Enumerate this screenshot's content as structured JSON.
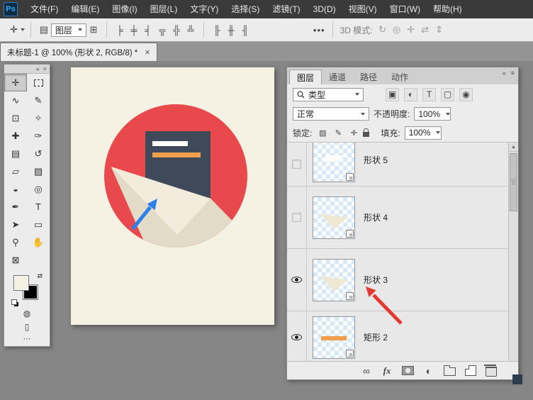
{
  "menu_bar": {
    "logo": "Ps",
    "items": [
      {
        "name": "menu-file",
        "label": "文件(F)"
      },
      {
        "name": "menu-edit",
        "label": "编辑(E)"
      },
      {
        "name": "menu-image",
        "label": "图像(I)"
      },
      {
        "name": "menu-layer",
        "label": "图层(L)"
      },
      {
        "name": "menu-type",
        "label": "文字(Y)"
      },
      {
        "name": "menu-select",
        "label": "选择(S)"
      },
      {
        "name": "menu-filter",
        "label": "滤镜(T)"
      },
      {
        "name": "menu-3d",
        "label": "3D(D)"
      },
      {
        "name": "menu-view",
        "label": "视图(V)"
      },
      {
        "name": "menu-window",
        "label": "窗口(W)"
      },
      {
        "name": "menu-help",
        "label": "帮助(H)"
      }
    ]
  },
  "options_bar": {
    "tool_glyph": "✛",
    "auto_select_glyph": "▤",
    "auto_select_value": "图层",
    "transform_glyph": "⊞",
    "align_icons": [
      {
        "name": "align-left-icon",
        "glyph": "╞"
      },
      {
        "name": "align-center-horizontal-icon",
        "glyph": "╪"
      },
      {
        "name": "align-right-icon",
        "glyph": "╡"
      },
      {
        "name": "align-top-icon",
        "glyph": "╦"
      },
      {
        "name": "align-middle-icon",
        "glyph": "╬"
      },
      {
        "name": "align-bottom-icon",
        "glyph": "╩"
      }
    ],
    "distribute_icons": [
      {
        "name": "distribute-left-icon",
        "glyph": "╟"
      },
      {
        "name": "distribute-center-icon",
        "glyph": "╫"
      },
      {
        "name": "distribute-right-icon",
        "glyph": "╢"
      }
    ],
    "more_label": "•••",
    "mode3d_label": "3D 模式:",
    "mode3d_icons": [
      {
        "name": "3d-rotate-icon",
        "glyph": "↻"
      },
      {
        "name": "3d-roll-icon",
        "glyph": "◎"
      },
      {
        "name": "3d-pan-icon",
        "glyph": "✛"
      },
      {
        "name": "3d-slide-icon",
        "glyph": "⇄"
      },
      {
        "name": "3d-scale-icon",
        "glyph": "⇕"
      }
    ]
  },
  "document_tab": {
    "label": "未标题-1 @ 100% (形状 2, RGB/8) *",
    "close_glyph": "×"
  },
  "tool_panel": {
    "header_icons": [
      {
        "name": "collapse-tools-icon",
        "glyph": "«"
      },
      {
        "name": "close-tools-icon",
        "glyph": "×"
      }
    ],
    "tools": [
      {
        "name": "move-tool",
        "glyph": "✛",
        "selected": true
      },
      {
        "name": "rectangular-marquee-tool",
        "cls": "dash-box"
      },
      {
        "name": "lasso-tool",
        "glyph": "∿"
      },
      {
        "name": "quick-selection-tool",
        "glyph": "✎"
      },
      {
        "name": "crop-tool",
        "glyph": "⊡"
      },
      {
        "name": "eyedropper-tool",
        "glyph": "✧"
      },
      {
        "name": "healing-brush-tool",
        "glyph": "✚"
      },
      {
        "name": "brush-tool",
        "glyph": "✑"
      },
      {
        "name": "clone-stamp-tool",
        "glyph": "▤"
      },
      {
        "name": "history-brush-tool",
        "glyph": "↺"
      },
      {
        "name": "eraser-tool",
        "glyph": "▱"
      },
      {
        "name": "gradient-tool",
        "glyph": "▨"
      },
      {
        "name": "blur-tool",
        "glyph": "◒"
      },
      {
        "name": "dodge-tool",
        "glyph": "◎"
      },
      {
        "name": "pen-tool",
        "glyph": "✒"
      },
      {
        "name": "type-tool",
        "glyph": "T"
      },
      {
        "name": "path-selection-tool",
        "glyph": "➤"
      },
      {
        "name": "rectangle-tool",
        "glyph": "▭"
      },
      {
        "name": "zoom-tool",
        "glyph": "⚲"
      },
      {
        "name": "hand-tool",
        "glyph": "✋"
      }
    ],
    "extra_tools": [
      {
        "name": "frame-tool",
        "glyph": "⊠"
      }
    ],
    "swap_colors_glyph": "⇄",
    "foreground_color": "#F4F0E2",
    "background_color": "#000000",
    "quick_mask_glyph": "◍",
    "screen_mode_glyph": "▯",
    "dots_glyph": "⋯"
  },
  "layers_panel": {
    "header_icons": [
      {
        "name": "collapse-layers-icon",
        "glyph": "«"
      },
      {
        "name": "panel-menu-icon",
        "glyph": "≡"
      }
    ],
    "tabs": [
      {
        "name": "tab-layers",
        "label": "图层",
        "active": true
      },
      {
        "name": "tab-channels",
        "label": "通道"
      },
      {
        "name": "tab-paths",
        "label": "路径"
      },
      {
        "name": "tab-actions",
        "label": "动作"
      }
    ],
    "filter_label": "类型",
    "filter_icons": [
      {
        "name": "filter-pixel-layers-icon",
        "glyph": "▣"
      },
      {
        "name": "filter-adjustment-layers-icon",
        "glyph": "◐"
      },
      {
        "name": "filter-type-layers-icon",
        "glyph": "T"
      },
      {
        "name": "filter-shape-layers-icon",
        "glyph": "▢"
      },
      {
        "name": "filter-smart-objects-icon",
        "glyph": "◉"
      }
    ],
    "blend_mode_value": "正常",
    "opacity_label": "不透明度:",
    "opacity_value": "100%",
    "lock_label": "锁定:",
    "lock_icons": [
      {
        "name": "lock-transparent-icon",
        "glyph": "▨"
      },
      {
        "name": "lock-pixels-icon",
        "glyph": "✎"
      },
      {
        "name": "lock-position-icon",
        "glyph": "✛"
      },
      {
        "name": "lock-all-icon",
        "cls": "i-lock"
      }
    ],
    "fill_label": "填充:",
    "fill_value": "100%",
    "scroll_up_glyph": "▲",
    "layers": [
      {
        "name": "形状 5",
        "visible": false,
        "thumb": "white-shape"
      },
      {
        "name": "形状 4",
        "visible": false,
        "thumb": "cream-blob"
      },
      {
        "name": "形状 3",
        "visible": true,
        "thumb": "cream-blob"
      },
      {
        "name": "矩形 2",
        "visible": true,
        "thumb": "orange-line"
      }
    ],
    "bottom_icons": [
      {
        "name": "link-layers-icon",
        "glyph": "∞"
      },
      {
        "name": "layer-style-icon",
        "glyph": "fx",
        "cls": "fx-icon"
      },
      {
        "name": "add-layer-mask-icon",
        "cls": "i-mask"
      },
      {
        "name": "adjustment-layer-icon",
        "glyph": "◐"
      },
      {
        "name": "new-group-icon",
        "cls": "i-folder"
      },
      {
        "name": "new-layer-icon",
        "cls": "i-newlayer"
      },
      {
        "name": "delete-layer-icon",
        "cls": "i-trash"
      }
    ]
  },
  "canvas": {
    "colors": {
      "canvas_bg": "#F5F1E3",
      "circle_red": "#E8494D",
      "document_dark": "#3E4A59",
      "accent_orange": "#F0A04B",
      "envelope_cream": "#F1ECDC",
      "envelope_shadow": "#E2DBC7",
      "annotation_blue": "#2F7FE8",
      "annotation_red": "#E23B33"
    }
  }
}
